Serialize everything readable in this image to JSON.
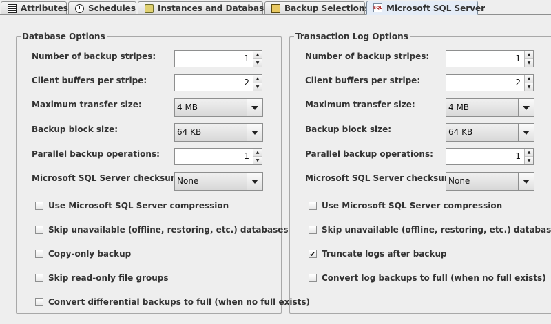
{
  "tabs": [
    {
      "label": "Attributes",
      "icon": "attributes-icon"
    },
    {
      "label": "Schedules",
      "icon": "schedules-icon"
    },
    {
      "label": "Instances and Databases",
      "icon": "instances-icon"
    },
    {
      "label": "Backup Selections",
      "icon": "backup-selections-icon"
    },
    {
      "label": "Microsoft SQL Server",
      "icon": "sql-server-icon",
      "active": true
    }
  ],
  "database_options": {
    "title": "Database Options",
    "stripes_label": "Number of backup stripes:",
    "stripes_value": "1",
    "buffers_label": "Client buffers per stripe:",
    "buffers_value": "2",
    "transfer_label": "Maximum transfer size:",
    "transfer_value": "4 MB",
    "block_label": "Backup block size:",
    "block_value": "64 KB",
    "parallel_label": "Parallel backup operations:",
    "parallel_value": "1",
    "checksum_label": "Microsoft SQL Server checksum:",
    "checksum_value": "None",
    "checkboxes": [
      {
        "label": "Use Microsoft SQL Server compression",
        "checked": false
      },
      {
        "label": "Skip unavailable (offline, restoring, etc.) databases",
        "checked": false
      },
      {
        "label": "Copy-only backup",
        "checked": false
      },
      {
        "label": "Skip read-only file groups",
        "checked": false
      },
      {
        "label": "Convert differential backups to full (when no full exists)",
        "checked": false
      }
    ]
  },
  "transaction_log_options": {
    "title": "Transaction Log Options",
    "stripes_label": "Number of backup stripes:",
    "stripes_value": "1",
    "buffers_label": "Client buffers per stripe:",
    "buffers_value": "2",
    "transfer_label": "Maximum transfer size:",
    "transfer_value": "4 MB",
    "block_label": "Backup block size:",
    "block_value": "64 KB",
    "parallel_label": "Parallel backup operations:",
    "parallel_value": "1",
    "checksum_label": "Microsoft SQL Server checksum:",
    "checksum_value": "None",
    "checkboxes": [
      {
        "label": "Use Microsoft SQL Server compression",
        "checked": false
      },
      {
        "label": "Skip unavailable (offline, restoring, etc.) databases",
        "checked": false
      },
      {
        "label": "Truncate logs after backup",
        "checked": true
      },
      {
        "label": "Convert log backups to full (when no full exists)",
        "checked": false
      }
    ]
  },
  "glyphs": {
    "checkmark": "✔",
    "spin_up": "▲",
    "spin_down": "▼"
  },
  "colors": {
    "background": "#eeeeee",
    "active_tab": "#e4ecf7",
    "border": "#8e8f8f"
  }
}
